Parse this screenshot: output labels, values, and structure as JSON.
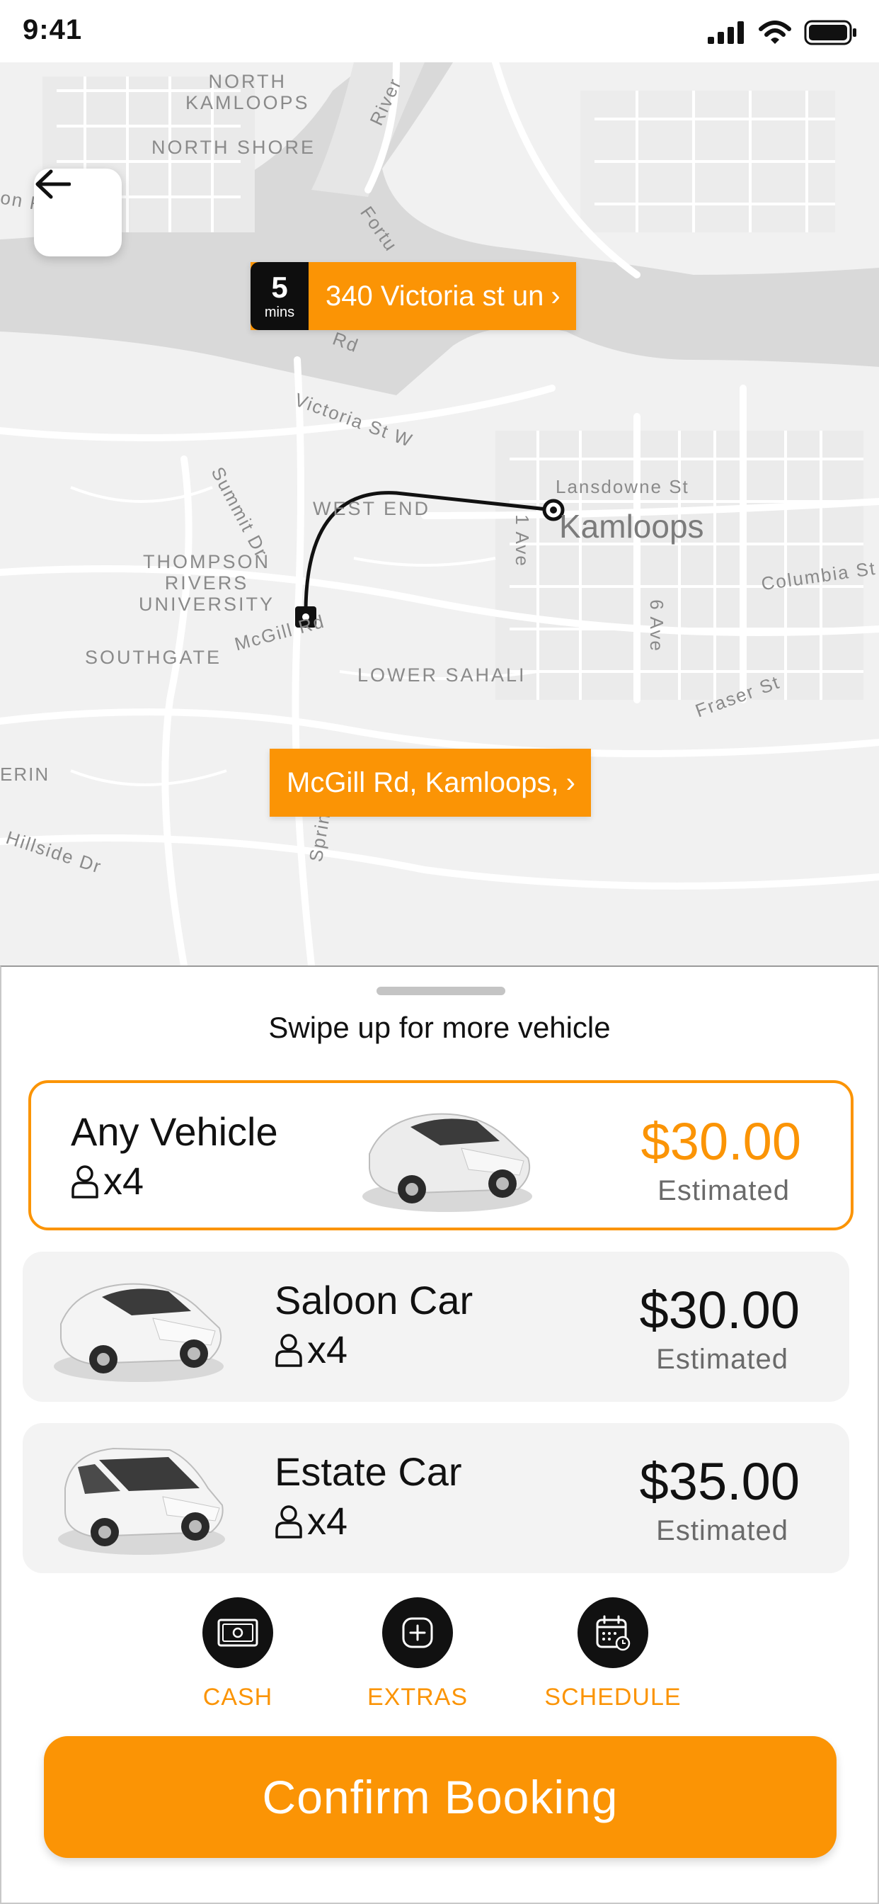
{
  "status_bar": {
    "time": "9:41"
  },
  "map": {
    "city_label": "Kamloops",
    "area_labels": [
      "NORTH KAMLOOPS",
      "NORTH SHORE",
      "WEST END",
      "THOMPSON RIVERS UNIVERSITY",
      "SOUTHGATE",
      "LOWER SAHALI"
    ],
    "street_labels": [
      "Victoria St W",
      "Summit Dr",
      "Lansdowne St",
      "1 Ave",
      "6 Ave",
      "Columbia St",
      "Fraser St",
      "McGill Rd",
      "Hillside Dr",
      "on River",
      "River",
      "ERIN",
      "Rd",
      "Fortu",
      "Spring"
    ],
    "pickup": {
      "eta_number": "5",
      "eta_unit": "mins",
      "address": "340 Victoria st un",
      "chevron": "›"
    },
    "dropoff": {
      "address": "McGill Rd, Kamloops,",
      "chevron": "›"
    }
  },
  "sheet": {
    "swipe_text": "Swipe up for more vehicle",
    "vehicles": [
      {
        "name": "Any Vehicle",
        "capacity": "x4",
        "price": "$30.00",
        "estimate_label": "Estimated",
        "selected": true
      },
      {
        "name": "Saloon Car",
        "capacity": "x4",
        "price": "$30.00",
        "estimate_label": "Estimated",
        "selected": false
      },
      {
        "name": "Estate Car",
        "capacity": "x4",
        "price": "$35.00",
        "estimate_label": "Estimated",
        "selected": false
      }
    ],
    "actions": [
      {
        "label": "CASH",
        "icon": "cash-icon"
      },
      {
        "label": "EXTRAS",
        "icon": "plus-icon"
      },
      {
        "label": "SCHEDULE",
        "icon": "calendar-icon"
      }
    ],
    "confirm_label": "Confirm Booking"
  },
  "colors": {
    "accent": "#fb9405",
    "dark": "#111111",
    "card": "#f3f3f3"
  }
}
